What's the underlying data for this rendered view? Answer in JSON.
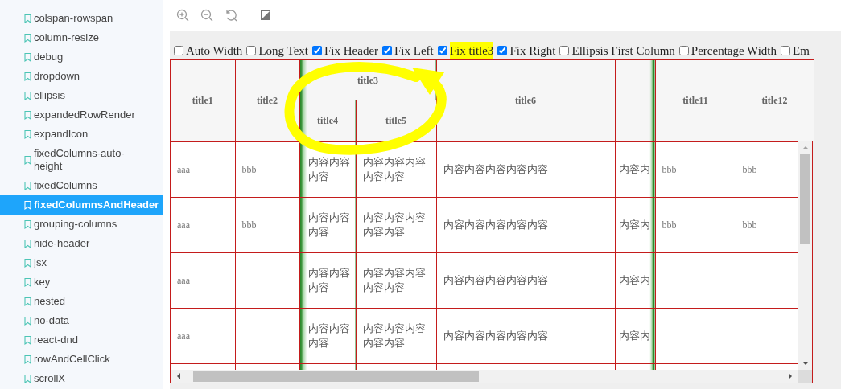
{
  "sidebar": {
    "items": [
      {
        "label": "colspan-rowspan",
        "selected": false
      },
      {
        "label": "column-resize",
        "selected": false
      },
      {
        "label": "debug",
        "selected": false
      },
      {
        "label": "dropdown",
        "selected": false
      },
      {
        "label": "ellipsis",
        "selected": false
      },
      {
        "label": "expandedRowRender",
        "selected": false
      },
      {
        "label": "expandIcon",
        "selected": false
      },
      {
        "label": "fixedColumns-auto-height",
        "selected": false
      },
      {
        "label": "fixedColumns",
        "selected": false
      },
      {
        "label": "fixedColumnsAndHeader",
        "selected": true
      },
      {
        "label": "grouping-columns",
        "selected": false
      },
      {
        "label": "hide-header",
        "selected": false
      },
      {
        "label": "jsx",
        "selected": false
      },
      {
        "label": "key",
        "selected": false
      },
      {
        "label": "nested",
        "selected": false
      },
      {
        "label": "no-data",
        "selected": false
      },
      {
        "label": "react-dnd",
        "selected": false
      },
      {
        "label": "rowAndCellClick",
        "selected": false
      },
      {
        "label": "scrollX",
        "selected": false
      }
    ]
  },
  "options": [
    {
      "label": "Auto Width",
      "checked": false,
      "highlighted": false
    },
    {
      "label": "Long Text",
      "checked": false,
      "highlighted": false
    },
    {
      "label": "Fix Header",
      "checked": true,
      "highlighted": false
    },
    {
      "label": "Fix Left",
      "checked": true,
      "highlighted": false
    },
    {
      "label": "Fix title3",
      "checked": true,
      "highlighted": true
    },
    {
      "label": "Fix Right",
      "checked": true,
      "highlighted": false
    },
    {
      "label": "Ellipsis First Column",
      "checked": false,
      "highlighted": false
    },
    {
      "label": "Percentage Width",
      "checked": false,
      "highlighted": false
    },
    {
      "label": "Em",
      "checked": false,
      "highlighted": false
    }
  ],
  "table": {
    "header_rows": [
      {
        "cells": [
          {
            "text": "title1",
            "rowspan": 2
          },
          {
            "text": "title2",
            "rowspan": 2
          },
          {
            "text": "title3",
            "colspan": 2
          },
          {
            "text": "title6",
            "rowspan": 2
          },
          {
            "rowspan": 2
          },
          {
            "text": "title11",
            "rowspan": 2
          },
          {
            "text": "title12",
            "rowspan": 2
          }
        ]
      },
      {
        "cells": [
          {
            "text": "title4"
          },
          {
            "text": "title5"
          }
        ]
      }
    ],
    "rows": [
      {
        "cells": [
          "aaa",
          "bbb",
          "内容内容内容",
          "内容内容内容内容内容",
          "内容内容内容内容内容",
          "内容内",
          "bbb",
          "bbb"
        ]
      },
      {
        "cells": [
          "aaa",
          "bbb",
          "内容内容内容",
          "内容内容内容内容内容",
          "内容内容内容内容内容",
          "内容内",
          "bbb",
          "bbb"
        ]
      },
      {
        "cells": [
          "aaa",
          null,
          "内容内容内容",
          "内容内容内容内容内容",
          "内容内容内容内容内容",
          "内容内",
          null,
          null
        ]
      },
      {
        "cells": [
          "aaa",
          null,
          "内容内容内容",
          "内容内容内容内容内容",
          "内容内容内容内容内容",
          "内容内",
          null,
          null
        ]
      }
    ]
  },
  "annotation": {
    "kind": "circle"
  }
}
